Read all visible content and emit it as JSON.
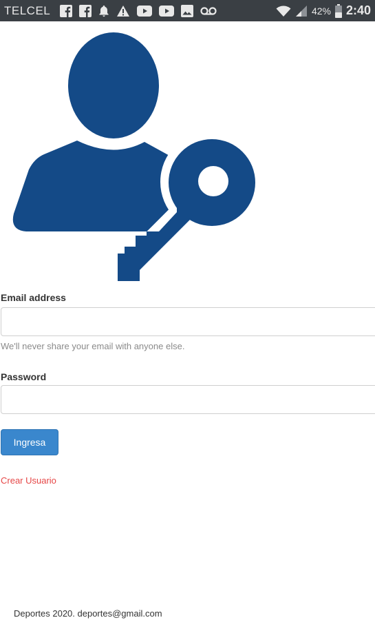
{
  "statusbar": {
    "carrier": "TELCEL",
    "left_icons": [
      "facebook-icon",
      "facebook-icon",
      "bell-icon",
      "warning-icon",
      "youtube-icon",
      "youtube-icon",
      "image-icon",
      "voicemail-icon"
    ],
    "right_icons": [
      "wifi-icon",
      "signal-icon"
    ],
    "battery": "42%",
    "time": "2:40",
    "color": "#3a3f44"
  },
  "hero": {
    "icon": "user-key-icon",
    "color": "#144a87"
  },
  "form": {
    "email_label": "Email address",
    "email_value": "",
    "email_placeholder": "",
    "email_help": "We'll never share your email with anyone else.",
    "password_label": "Password",
    "password_value": "",
    "password_placeholder": "",
    "submit_label": "Ingresa",
    "create_user_link": "Crear Usuario"
  },
  "colors": {
    "accent": "#3a87cd",
    "link": "#e64646"
  },
  "footer": {
    "text": "Deportes 2020. deportes@gmail.com"
  }
}
